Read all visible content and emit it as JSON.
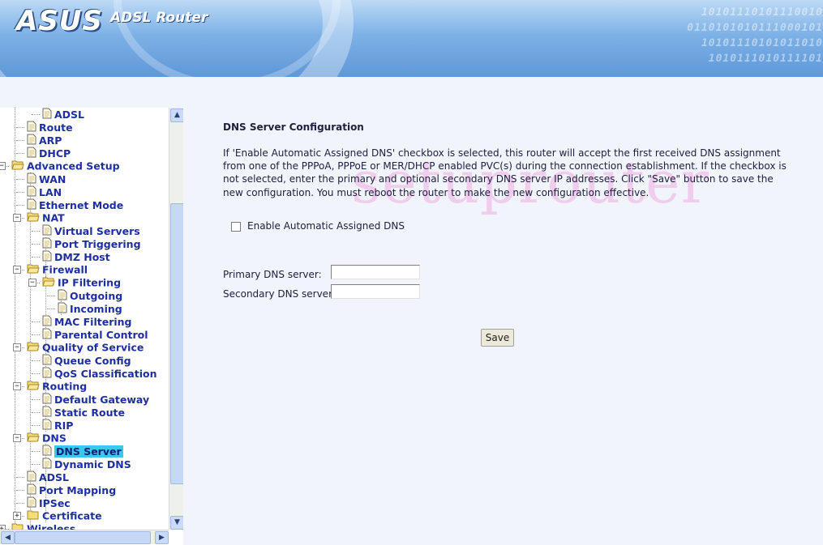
{
  "header": {
    "logo": "ASUS",
    "product": "ADSL Router",
    "binary_lines": [
      "10101110101110010",
      "0110101010111000101",
      "10101110101011010",
      "1010111010111101"
    ]
  },
  "tree": {
    "items": [
      {
        "label": "ADSL",
        "icon": "page-icon",
        "level": 3
      },
      {
        "label": "Route",
        "icon": "page-icon",
        "level": 2
      },
      {
        "label": "ARP",
        "icon": "page-icon",
        "level": 2
      },
      {
        "label": "DHCP",
        "icon": "page-icon",
        "level": 2
      },
      {
        "label": "Advanced Setup",
        "icon": "folder-open-icon",
        "level": 1,
        "expanded": true
      },
      {
        "label": "WAN",
        "icon": "page-icon",
        "level": 2
      },
      {
        "label": "LAN",
        "icon": "page-icon",
        "level": 2
      },
      {
        "label": "Ethernet Mode",
        "icon": "page-icon",
        "level": 2
      },
      {
        "label": "NAT",
        "icon": "folder-open-icon",
        "level": 2,
        "expanded": true
      },
      {
        "label": "Virtual Servers",
        "icon": "page-icon",
        "level": 3
      },
      {
        "label": "Port Triggering",
        "icon": "page-icon",
        "level": 3
      },
      {
        "label": "DMZ Host",
        "icon": "page-icon",
        "level": 3
      },
      {
        "label": "Firewall",
        "icon": "folder-open-icon",
        "level": 2,
        "expanded": true
      },
      {
        "label": "IP Filtering",
        "icon": "folder-open-icon",
        "level": 3,
        "expanded": true
      },
      {
        "label": "Outgoing",
        "icon": "page-icon",
        "level": 4
      },
      {
        "label": "Incoming",
        "icon": "page-icon",
        "level": 4
      },
      {
        "label": "MAC Filtering",
        "icon": "page-icon",
        "level": 3
      },
      {
        "label": "Parental Control",
        "icon": "page-icon",
        "level": 3
      },
      {
        "label": "Quality of Service",
        "icon": "folder-open-icon",
        "level": 2,
        "expanded": true
      },
      {
        "label": "Queue Config",
        "icon": "page-icon",
        "level": 3
      },
      {
        "label": "QoS Classification",
        "icon": "page-icon",
        "level": 3
      },
      {
        "label": "Routing",
        "icon": "folder-open-icon",
        "level": 2,
        "expanded": true
      },
      {
        "label": "Default Gateway",
        "icon": "page-icon",
        "level": 3
      },
      {
        "label": "Static Route",
        "icon": "page-icon",
        "level": 3
      },
      {
        "label": "RIP",
        "icon": "page-icon",
        "level": 3
      },
      {
        "label": "DNS",
        "icon": "folder-open-icon",
        "level": 2,
        "expanded": true
      },
      {
        "label": "DNS Server",
        "icon": "page-icon",
        "level": 3,
        "selected": true
      },
      {
        "label": "Dynamic DNS",
        "icon": "page-icon",
        "level": 3
      },
      {
        "label": "ADSL",
        "icon": "page-icon",
        "level": 2
      },
      {
        "label": "Port Mapping",
        "icon": "page-icon",
        "level": 2
      },
      {
        "label": "IPSec",
        "icon": "page-icon",
        "level": 2
      },
      {
        "label": "Certificate",
        "icon": "folder-closed-icon",
        "level": 2,
        "expanded": false
      },
      {
        "label": "Wireless",
        "icon": "folder-closed-icon",
        "level": 1,
        "expanded": false
      }
    ],
    "selected_color": "#38c8e8",
    "link_color": "#1f2fa0"
  },
  "main": {
    "title": "DNS Server Configuration",
    "description": "If 'Enable Automatic Assigned DNS' checkbox is selected, this router will accept the first received DNS assignment from one of the PPPoA, PPPoE or MER/DHCP enabled PVC(s) during the connection establishment. If the checkbox is not selected, enter the primary and optional secondary DNS server IP addresses. Click \"Save\" button to save the new configuration. You must reboot the router to make the new configuration effective.",
    "auto_dns_label": "Enable Automatic Assigned DNS",
    "auto_dns_checked": false,
    "primary_label": "Primary DNS server:",
    "primary_value": "",
    "secondary_label": "Secondary DNS server:",
    "secondary_value": "",
    "save_label": "Save",
    "watermark": "setuprouter"
  }
}
